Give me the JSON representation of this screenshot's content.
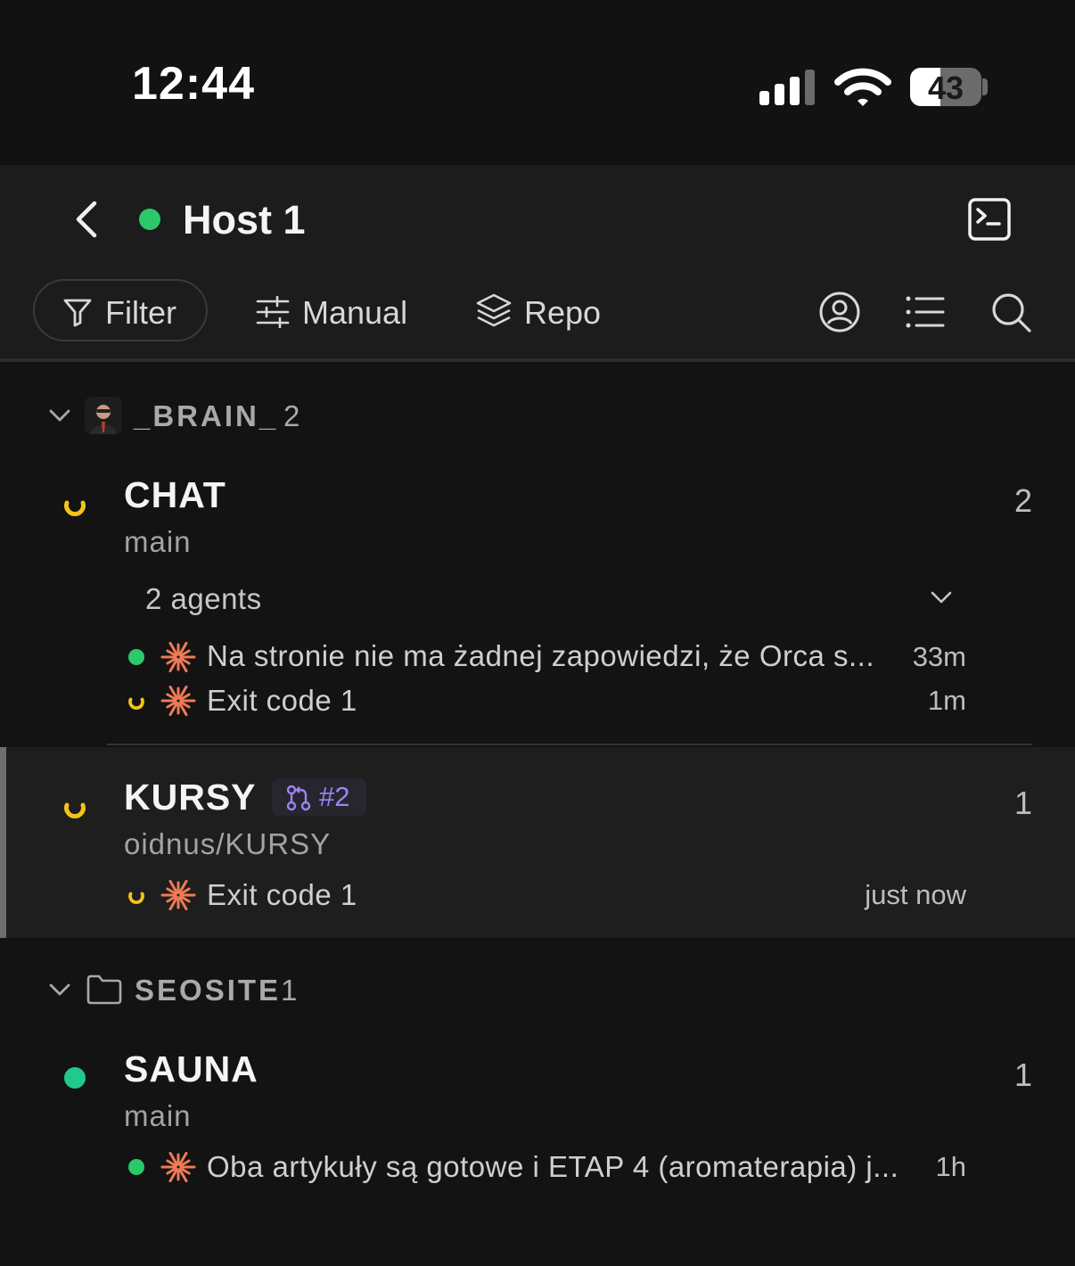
{
  "status_bar": {
    "time": "12:44",
    "battery_level": "43",
    "battery_fraction": 0.43
  },
  "header": {
    "title": "Host 1",
    "status_color": "#2bc96a",
    "toolbar": {
      "filter_label": "Filter",
      "manual_label": "Manual",
      "repo_label": "Repo"
    }
  },
  "groups": [
    {
      "name": "_BRAIN_",
      "count": "2",
      "projects": [
        {
          "name": "CHAT",
          "branch": "main",
          "count": "2",
          "agents_label": "2 agents",
          "agents": [
            {
              "status": "active",
              "text": "Na stronie nie ma żadnej zapowiedzi, że Orca s...",
              "time": "33m"
            },
            {
              "status": "loading",
              "text": "Exit code 1",
              "time": "1m"
            }
          ]
        },
        {
          "name": "KURSY",
          "pr_label": "#2",
          "branch": "oidnus/KURSY",
          "count": "1",
          "agents": [
            {
              "status": "loading",
              "text": "Exit code 1",
              "time": "just now"
            }
          ]
        }
      ]
    },
    {
      "name": "SEOSITE",
      "count": "1",
      "projects": [
        {
          "name": "SAUNA",
          "branch": "main",
          "count": "1",
          "agents": [
            {
              "status": "active",
              "text": "Oba artykuły są gotowe i ETAP 4 (aromaterapia) j...",
              "time": "1h"
            }
          ]
        }
      ]
    }
  ],
  "colors": {
    "active_green": "#2bc96a",
    "loading_yellow": "#f2c318",
    "agent_orange": "#f07a55",
    "pr_purple": "#9d83f5"
  },
  "icons": [
    "back-chevron-icon",
    "terminal-icon",
    "filter-icon",
    "sliders-icon",
    "layers-icon",
    "account-icon",
    "list-icon",
    "search-icon",
    "chevron-down-icon",
    "folder-icon",
    "spinner-icon",
    "sparkle-icon",
    "pull-request-icon"
  ]
}
